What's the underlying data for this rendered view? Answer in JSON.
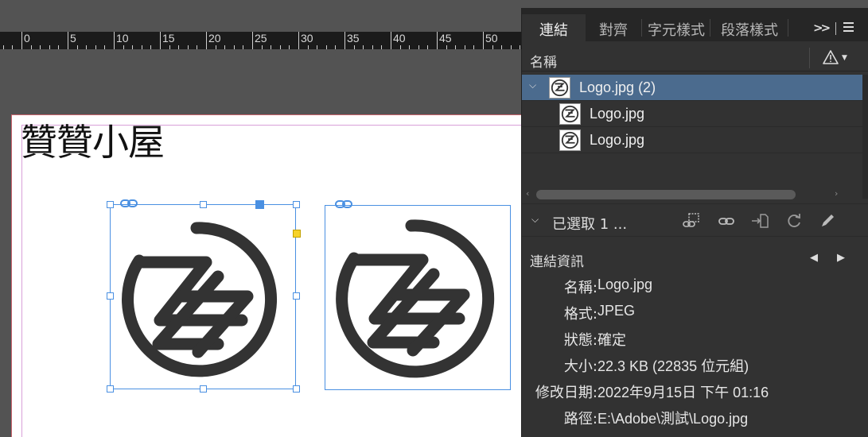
{
  "document": {
    "title_text": "贊贊小屋",
    "ruler_labels": [
      "0",
      "5",
      "10",
      "15",
      "20",
      "25",
      "30",
      "35",
      "40",
      "45",
      "50"
    ]
  },
  "panel": {
    "tabs": [
      {
        "label": "連結",
        "active": true
      },
      {
        "label": "對齊",
        "active": false
      },
      {
        "label": "字元樣式",
        "active": false
      },
      {
        "label": "段落樣式",
        "active": false
      }
    ],
    "overflow_label": ">>",
    "column_header": "名稱",
    "links": [
      {
        "label": "Logo.jpg (2)",
        "selected": true,
        "expandable": true
      },
      {
        "label": "Logo.jpg",
        "selected": false,
        "expandable": false
      },
      {
        "label": "Logo.jpg",
        "selected": false,
        "expandable": false
      }
    ],
    "selected_count": "已選取 1 ...",
    "info_title": "連結資訊",
    "info": [
      {
        "key": "名稱:",
        "value": "Logo.jpg"
      },
      {
        "key": "格式:",
        "value": "JPEG"
      },
      {
        "key": "狀態:",
        "value": "確定"
      },
      {
        "key": "大小:",
        "value": "22.3  KB  (22835 位元組)"
      },
      {
        "key": "修改日期:",
        "value": "2022年9月15日 下午 01:16"
      },
      {
        "key": "路徑:",
        "value": "E:\\Adobe\\測試\\Logo.jpg"
      }
    ]
  },
  "colors": {
    "selection_blue": "#4a90e2",
    "selected_row": "#4b6b8e",
    "panel_bg": "#323232",
    "logo_color": "#333333"
  },
  "icons": [
    "link-badge-icon",
    "warning-icon",
    "relink-icon",
    "go-to-link-icon",
    "embed-icon",
    "update-link-icon",
    "edit-original-icon",
    "prev-icon",
    "next-icon",
    "panel-menu-icon"
  ]
}
